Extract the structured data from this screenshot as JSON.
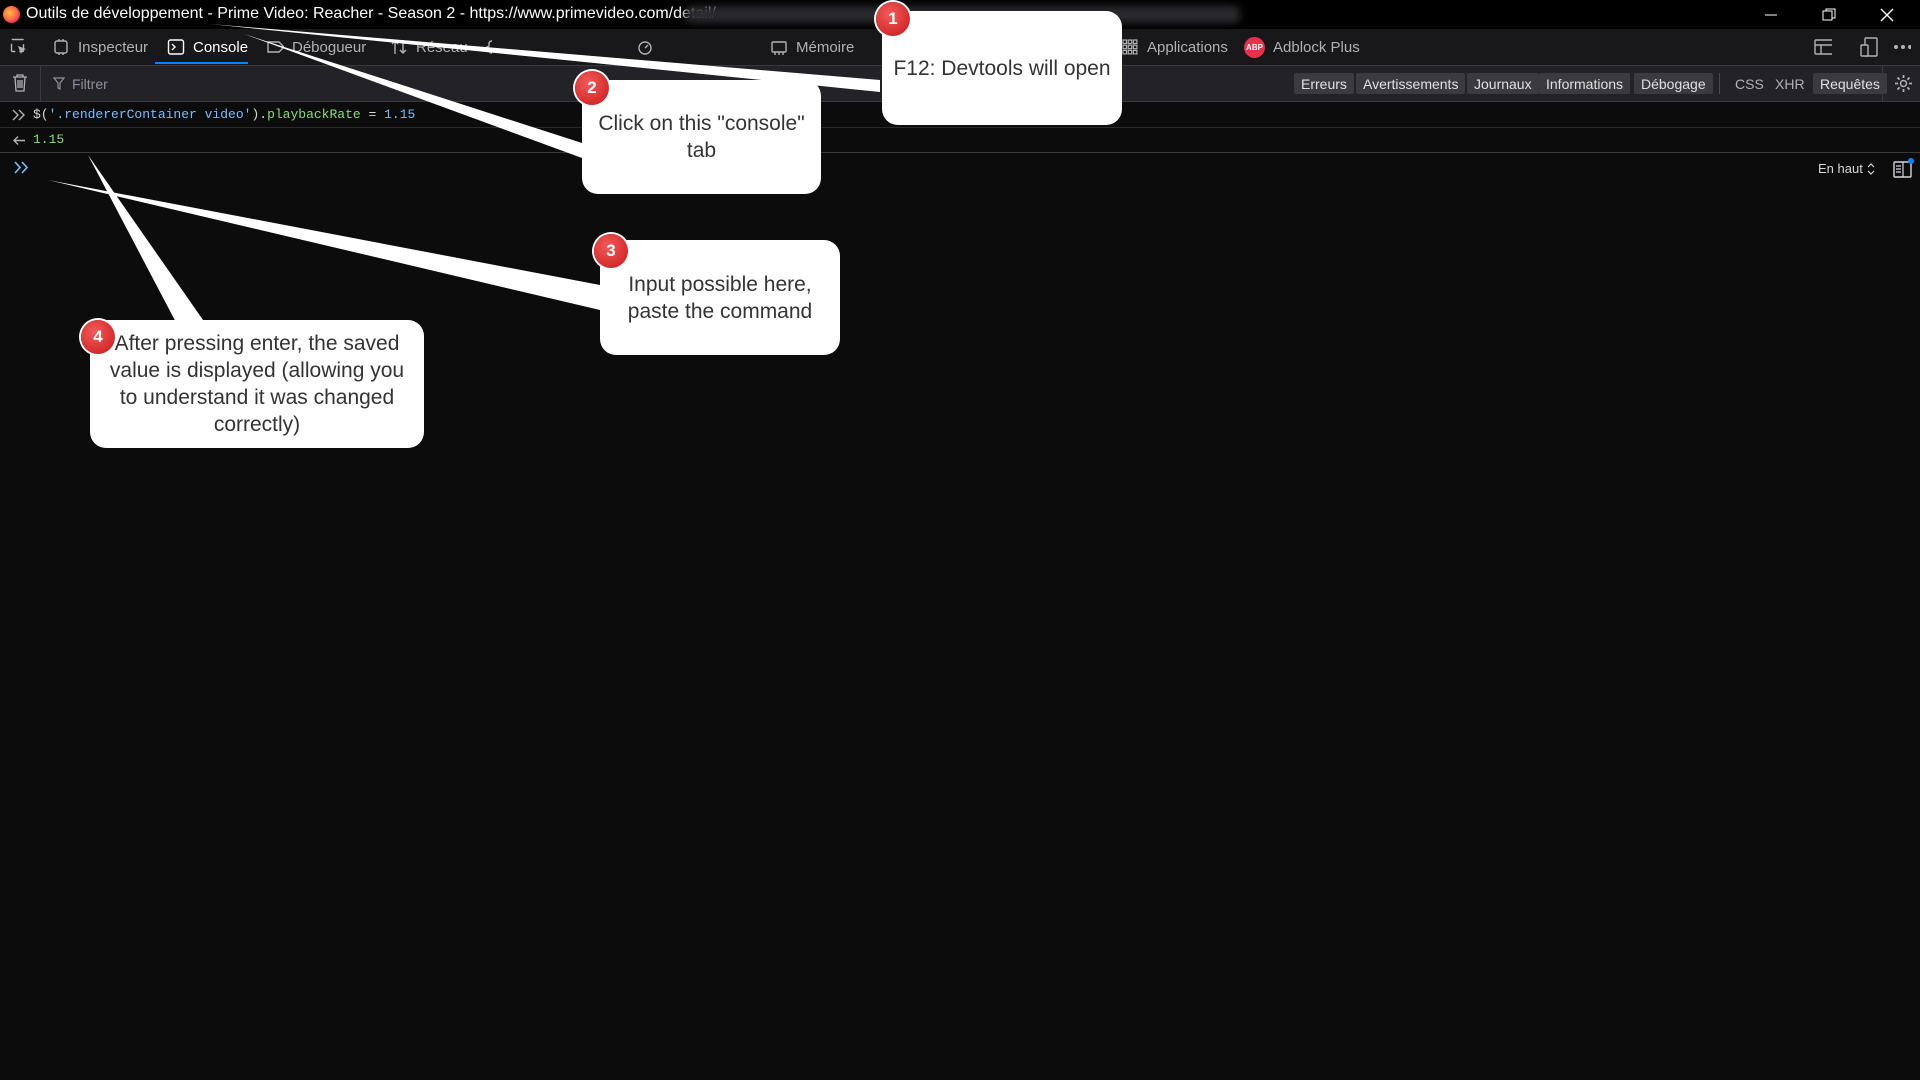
{
  "window": {
    "title": "Outils de développement - Prime Video: Reacher - Season 2 - https://www.primevideo.com/detail/"
  },
  "toolbar": {
    "tabs": [
      {
        "label": "Inspecteur"
      },
      {
        "label": "Console"
      },
      {
        "label": "Débogueur"
      },
      {
        "label": "Réseau"
      },
      {
        "label": "Mémoire"
      },
      {
        "label": "Applications"
      },
      {
        "label": "Adblock Plus"
      }
    ],
    "abp_badge": "ABP"
  },
  "filterbar": {
    "placeholder": "Filtrer",
    "levels": [
      "Erreurs",
      "Avertissements",
      "Journaux",
      "Informations",
      "Débogage"
    ],
    "extras": [
      "CSS",
      "XHR",
      "Requêtes"
    ]
  },
  "console": {
    "input_parts": {
      "p1": "$(",
      "p2": "'.rendererContainer video'",
      "p3": ").",
      "p4": "playbackRate",
      "p5": " = ",
      "p6": "1.15"
    },
    "output": "1.15",
    "position": "En haut"
  },
  "callouts": [
    {
      "number": "1",
      "text": "F12: Devtools will open"
    },
    {
      "number": "2",
      "text": "Click on this \"console\" tab"
    },
    {
      "number": "3",
      "text": "Input possible here, paste the command"
    },
    {
      "number": "4",
      "text": "After pressing enter, the saved value is displayed (allowing you to understand it was changed correctly)"
    }
  ],
  "colors": {
    "accent": "#0a84ff",
    "marker": "#d42020",
    "background": "#0c0c0d"
  }
}
